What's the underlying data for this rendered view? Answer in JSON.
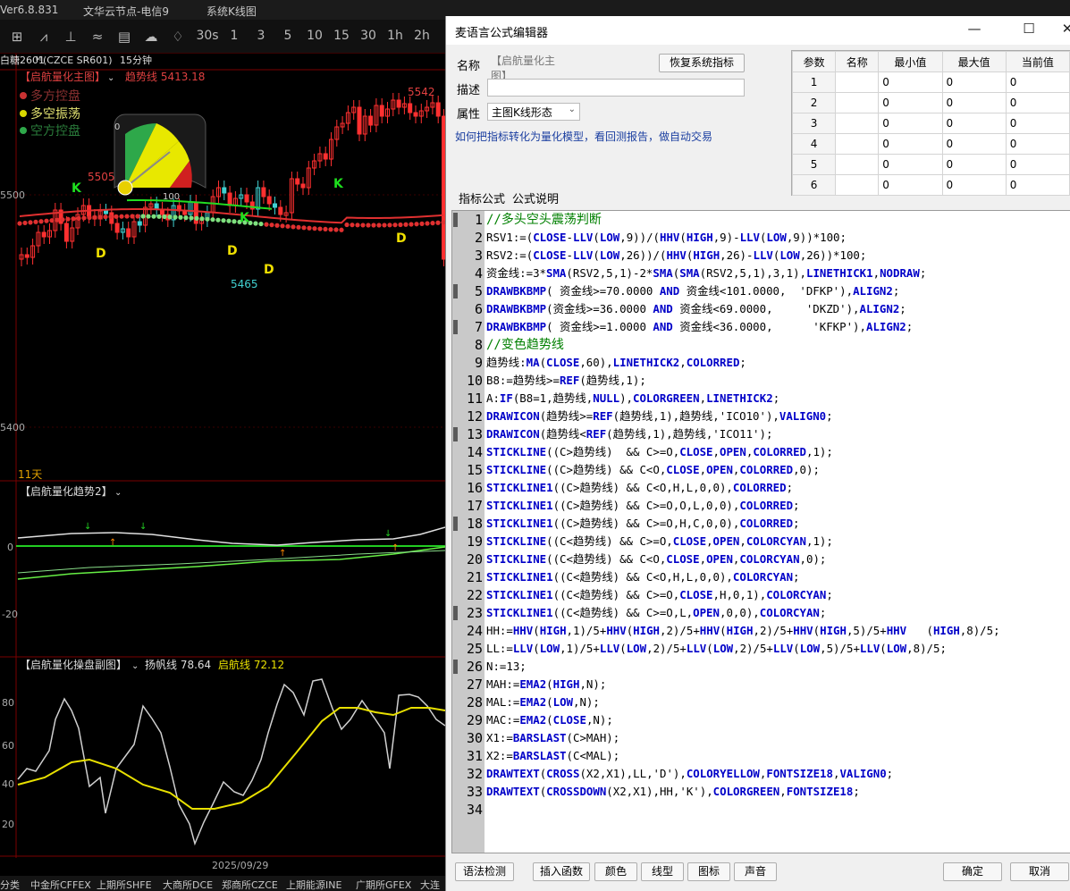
{
  "app": {
    "version": "Ver6.8.831",
    "node": "文华云节点-电信9",
    "chart_type": "系统K线图"
  },
  "toolbar": {
    "time_buttons": [
      "30s",
      "1",
      "3",
      "5",
      "10",
      "15",
      "30",
      "1h",
      "2h",
      "3"
    ]
  },
  "chart": {
    "contract": "白糖2601",
    "contract_sup": "M",
    "code": "(CZCE SR601)",
    "period": "15分钟",
    "main_title": "【启航量化主图】",
    "trend_label": "趋势线 5413.18",
    "legend": [
      "多方控盘",
      "多空振荡",
      "空方控盘"
    ],
    "legend_colors": [
      "#c83232",
      "#d8d800",
      "#2ea84a"
    ],
    "gauge_labels": [
      "0",
      "100"
    ],
    "price_labels": [
      "5542",
      "5505",
      "5465"
    ],
    "k_marks": [
      "K",
      "K",
      "K"
    ],
    "d_marks": [
      "D",
      "D",
      "D",
      "D"
    ],
    "y_ticks_main": [
      "5500",
      "5400"
    ],
    "days": "11天",
    "sub1_title": "【启航量化趋势2】",
    "sub1_ticks": [
      "0",
      "-20"
    ],
    "sub2_title": "【启航量化操盘副图】",
    "sub2_line1": "扬帆线 78.64",
    "sub2_line2": "启航线 72.12",
    "sub2_ticks": [
      "80",
      "60",
      "40",
      "20"
    ],
    "date": "2025/09/29"
  },
  "bottom_tabs": [
    "分类",
    "中金所CFFEX",
    "上期所SHFE",
    "大商所DCE",
    "郑商所CZCE",
    "上期能源INE",
    "广期所GFEX",
    "大连"
  ],
  "dialog": {
    "title": "麦语言公式编辑器",
    "name_label": "名称",
    "name_value": "【启航量化主图】",
    "restore_button": "恢复系统指标",
    "desc_label": "描述",
    "attr_label": "属性",
    "attr_value": "主图K线形态",
    "link_text": "如何把指标转化为量化模型，看回测报告，做自动交易",
    "tabs": [
      "指标公式",
      "公式说明"
    ],
    "param_headers": [
      "参数",
      "名称",
      "最小值",
      "最大值",
      "当前值"
    ],
    "param_rows": [
      [
        "1",
        "",
        "0",
        "0",
        "0"
      ],
      [
        "2",
        "",
        "0",
        "0",
        "0"
      ],
      [
        "3",
        "",
        "0",
        "0",
        "0"
      ],
      [
        "4",
        "",
        "0",
        "0",
        "0"
      ],
      [
        "5",
        "",
        "0",
        "0",
        "0"
      ],
      [
        "6",
        "",
        "0",
        "0",
        "0"
      ]
    ],
    "code_lines": [
      "//多头空头震荡判断",
      "RSV1:=(CLOSE-LLV(LOW,9))/(HHV(HIGH,9)-LLV(LOW,9))*100;",
      "RSV2:=(CLOSE-LLV(LOW,26))/(HHV(HIGH,26)-LLV(LOW,26))*100;",
      "资金线:=3*SMA(RSV2,5,1)-2*SMA(SMA(RSV2,5,1),3,1),LINETHICK1,NODRAW;",
      "DRAWBKBMP( 资金线>=70.0000 AND 资金线<101.0000,  'DFKP'),ALIGN2;",
      "DRAWBKBMP(资金线>=36.0000 AND 资金线<69.0000,     'DKZD'),ALIGN2;",
      "DRAWBKBMP( 资金线>=1.0000 AND 资金线<36.0000,      'KFKP'),ALIGN2;",
      "//变色趋势线",
      "趋势线:MA(CLOSE,60),LINETHICK2,COLORRED;",
      "B8:=趋势线>=REF(趋势线,1);",
      "A:IF(B8=1,趋势线,NULL),COLORGREEN,LINETHICK2;",
      "DRAWICON(趋势线>=REF(趋势线,1),趋势线,'ICO10'),VALIGN0;",
      "DRAWICON(趋势线<REF(趋势线,1),趋势线,'ICO11');",
      "STICKLINE((C>趋势线)  && C>=O,CLOSE,OPEN,COLORRED,1);",
      "STICKLINE((C>趋势线) && C<O,CLOSE,OPEN,COLORRED,0);",
      "STICKLINE1((C>趋势线) && C<O,H,L,0,0),COLORRED;",
      "STICKLINE1((C>趋势线) && C>=O,O,L,0,0),COLORRED;",
      "STICKLINE1((C>趋势线) && C>=O,H,C,0,0),COLORRED;",
      "STICKLINE((C<趋势线) && C>=O,CLOSE,OPEN,COLORCYAN,1);",
      "STICKLINE((C<趋势线) && C<O,CLOSE,OPEN,COLORCYAN,0);",
      "STICKLINE1((C<趋势线) && C<O,H,L,0,0),COLORCYAN;",
      "STICKLINE1((C<趋势线) && C>=O,CLOSE,H,0,1),COLORCYAN;",
      "STICKLINE1((C<趋势线) && C>=O,L,OPEN,0,0),COLORCYAN;",
      "HH:=HHV(HIGH,1)/5+HHV(HIGH,2)/5+HHV(HIGH,2)/5+HHV(HIGH,5)/5+HHV   (HIGH,8)/5;",
      "LL:=LLV(LOW,1)/5+LLV(LOW,2)/5+LLV(LOW,2)/5+LLV(LOW,5)/5+LLV(LOW,8)/5;",
      "N:=13;",
      "MAH:=EMA2(HIGH,N);",
      "MAL:=EMA2(LOW,N);",
      "MAC:=EMA2(CLOSE,N);",
      "X1:=BARSLAST(C>MAH);",
      "X2:=BARSLAST(C<MAL);",
      "DRAWTEXT(CROSS(X2,X1),LL,'D'),COLORYELLOW,FONTSIZE18,VALIGN0;",
      "DRAWTEXT(CROSSDOWN(X2,X1),HH,'K'),COLORGREEN,FONTSIZE18;",
      ""
    ],
    "bottom_buttons": [
      "语法检测",
      "插入函数",
      "颜色",
      "线型",
      "图标",
      "声音"
    ],
    "ok": "确定",
    "cancel": "取消"
  }
}
